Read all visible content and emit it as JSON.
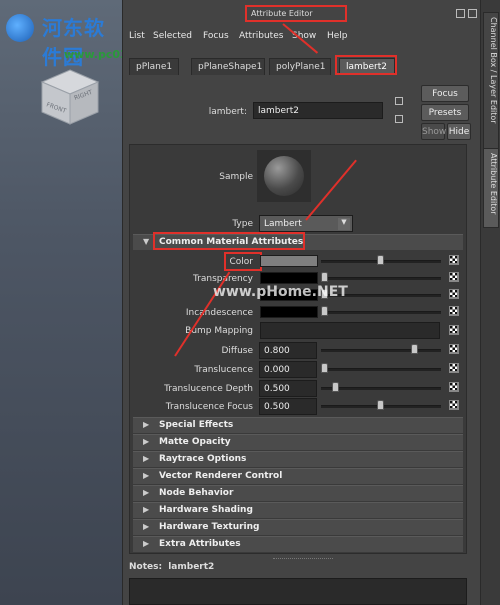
{
  "watermark": {
    "site_name": "河东软件园",
    "url": "www.pc0359.cn",
    "overlay": "www.pHome.NET"
  },
  "viewcube": {
    "front": "FRONT",
    "right": "RIGHT"
  },
  "editor": {
    "title": "Attribute Editor",
    "menu": [
      "List",
      "Selected",
      "Focus",
      "Attributes",
      "Show",
      "Help"
    ],
    "tabs": [
      "pPlane1",
      "pPlaneShape1",
      "polyPlane1",
      "lambert2"
    ],
    "active_tab": "lambert2",
    "node_label": "lambert:",
    "node_name": "lambert2",
    "buttons": {
      "focus": "Focus",
      "presets": "Presets",
      "show": "Show",
      "hide": "Hide"
    },
    "sample_label": "Sample",
    "type_label": "Type",
    "type_value": "Lambert",
    "common_section": "Common Material Attributes",
    "attributes": {
      "color": {
        "label": "Color",
        "value": 0.5
      },
      "transparency": {
        "label": "Transparency",
        "value": 0.0
      },
      "incandescence": {
        "label": "Incandescence",
        "value": 0.0
      },
      "bump_mapping": {
        "label": "Bump Mapping"
      },
      "diffuse": {
        "label": "Diffuse",
        "value": "0.800"
      },
      "translucence": {
        "label": "Translucence",
        "value": "0.000"
      },
      "translucence_depth": {
        "label": "Translucence Depth",
        "value": "0.500"
      },
      "translucence_focus": {
        "label": "Translucence Focus",
        "value": "0.500"
      }
    },
    "sections": [
      "Special Effects",
      "Matte Opacity",
      "Raytrace Options",
      "Vector Renderer Control",
      "Node Behavior",
      "Hardware Shading",
      "Hardware Texturing",
      "Extra Attributes"
    ],
    "notes_label": "Notes:",
    "notes_node": "lambert2"
  },
  "side_tabs": [
    "Channel Box / Layer Editor",
    "Attribute Editor"
  ],
  "colors": {
    "highlight": "#e0302a",
    "panel_bg": "#444444",
    "color_swatch": "#7f7f7f"
  }
}
